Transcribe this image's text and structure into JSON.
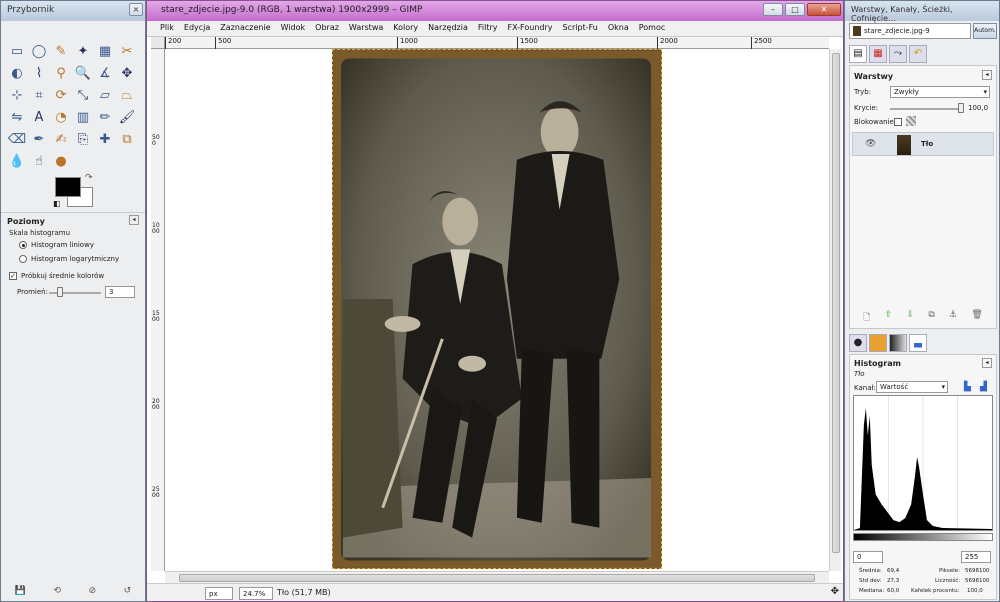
{
  "toolbox": {
    "title": "Przybornik",
    "close": "×",
    "tools": [
      {
        "icon": "rect-select-icon",
        "glyph": "▭"
      },
      {
        "icon": "ellipse-select-icon",
        "glyph": "◯"
      },
      {
        "icon": "free-select-icon",
        "glyph": "✎"
      },
      {
        "icon": "fuzzy-select-icon",
        "glyph": "✦"
      },
      {
        "icon": "color-select-icon",
        "glyph": "▦"
      },
      {
        "icon": "scissors-icon",
        "glyph": "✂"
      },
      {
        "icon": "foreground-select-icon",
        "glyph": "◐"
      },
      {
        "icon": "paths-icon",
        "glyph": "⌇"
      },
      {
        "icon": "color-picker-icon",
        "glyph": "⚲"
      },
      {
        "icon": "zoom-icon",
        "glyph": "🔍"
      },
      {
        "icon": "measure-icon",
        "glyph": "∡"
      },
      {
        "icon": "move-icon",
        "glyph": "✥"
      },
      {
        "icon": "align-icon",
        "glyph": "⊹"
      },
      {
        "icon": "crop-icon",
        "glyph": "⌗"
      },
      {
        "icon": "rotate-icon",
        "glyph": "⟳"
      },
      {
        "icon": "scale-icon",
        "glyph": "⤡"
      },
      {
        "icon": "shear-icon",
        "glyph": "▱"
      },
      {
        "icon": "perspective-icon",
        "glyph": "⏢"
      },
      {
        "icon": "flip-icon",
        "glyph": "⇋"
      },
      {
        "icon": "text-icon",
        "glyph": "A"
      },
      {
        "icon": "bucket-fill-icon",
        "glyph": "◔"
      },
      {
        "icon": "blend-icon",
        "glyph": "▥"
      },
      {
        "icon": "pencil-icon",
        "glyph": "✏"
      },
      {
        "icon": "paintbrush-icon",
        "glyph": "🖌"
      },
      {
        "icon": "eraser-icon",
        "glyph": "⌫"
      },
      {
        "icon": "airbrush-icon",
        "glyph": "✒"
      },
      {
        "icon": "ink-icon",
        "glyph": "✍"
      },
      {
        "icon": "clone-icon",
        "glyph": "⎘"
      },
      {
        "icon": "heal-icon",
        "glyph": "✚"
      },
      {
        "icon": "perspective-clone-icon",
        "glyph": "⧉"
      },
      {
        "icon": "blur-icon",
        "glyph": "💧"
      },
      {
        "icon": "smudge-icon",
        "glyph": "☝"
      },
      {
        "icon": "dodge-burn-icon",
        "glyph": "●"
      }
    ],
    "panel_title": "Poziomy",
    "scale_label": "Skala histogramu",
    "opt_linear": "Histogram liniowy",
    "opt_log": "Histogram logarytmiczny",
    "sample_merged": "Próbkuj średnie kolorów",
    "radius_label": "Promień:",
    "radius_value": "3"
  },
  "imagewin": {
    "title": "stare_zdjecie.jpg-9.0 (RGB, 1 warstwa) 1900x2999 – GIMP",
    "menu": [
      "Plik",
      "Edycja",
      "Zaznaczenie",
      "Widok",
      "Obraz",
      "Warstwa",
      "Kolory",
      "Narzędzia",
      "Filtry",
      "FX-Foundry",
      "Script-Fu",
      "Okna",
      "Pomoc"
    ],
    "ruler_h": [
      "200",
      "500",
      "1000",
      "1500",
      "2000",
      "2500"
    ],
    "ruler_v": [
      "500",
      "1000",
      "1500",
      "2000",
      "2500"
    ],
    "unit": "px",
    "zoom": "24.7%",
    "status": "Tło (51,7 MB)"
  },
  "dock": {
    "title": "Warstwy, Kanały, Ścieżki, Cofnięcie...",
    "image_select": "stare_zdjecie.jpg-9",
    "auto": "Autom.",
    "layers_title": "Warstwy",
    "mode_label": "Tryb:",
    "mode_value": "Zwykły",
    "opacity_label": "Krycie:",
    "opacity_value": "100,0",
    "lock_label": "Blokowanie:",
    "layer_name": "Tło",
    "histogram_title": "Histogram",
    "histogram_layer": "Tło",
    "channel_label": "Kanał:",
    "channel_value": "Wartość",
    "range_min": "0",
    "range_max": "255",
    "stats": {
      "mean_label": "Średnia:",
      "mean": "69,4",
      "std_label": "Std dev:",
      "std": "27,3",
      "median_label": "Mediana:",
      "median": "60,0",
      "pixels_label": "Piksele:",
      "pixels": "5698100",
      "count_label": "Liczność:",
      "count": "5698100",
      "pct_label": "Kafelek procentu:",
      "pct": "100,0"
    }
  }
}
